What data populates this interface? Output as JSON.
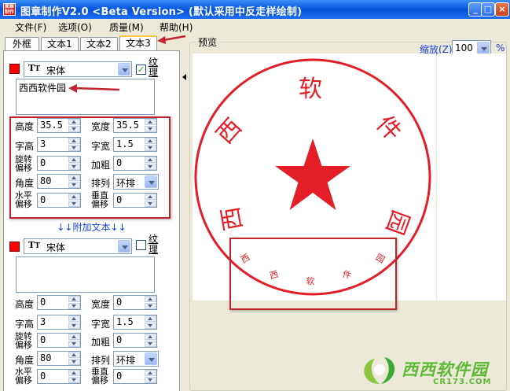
{
  "window": {
    "title": "图章制作V2.0 <Beta Version> (默认采用中反走样绘制)",
    "icon_text": "图章制作"
  },
  "menu": [
    "文件(F)",
    "选项(O)",
    "质量(M)",
    "帮助(H)"
  ],
  "tabs": [
    "外框",
    "文本1",
    "文本2",
    "文本3"
  ],
  "active_tab": "文本3",
  "text1": {
    "color": "#ff0000",
    "font": "宋体",
    "texture_label": "纹理",
    "texture_checked": true,
    "content": "西西软件园",
    "fields": {
      "height": {
        "label": "高度",
        "value": "35.5"
      },
      "width": {
        "label": "宽度",
        "value": "35.5"
      },
      "char_height": {
        "label": "字高",
        "value": "3"
      },
      "char_width": {
        "label": "字宽",
        "value": "1.5"
      },
      "rotate_offset": {
        "label": "旋转偏移",
        "value": "0"
      },
      "bold": {
        "label": "加粗",
        "value": "0"
      },
      "angle": {
        "label": "角度",
        "value": "80"
      },
      "arrange": {
        "label": "排列",
        "value": "环排"
      },
      "h_offset": {
        "label": "水平偏移",
        "value": "0"
      },
      "v_offset": {
        "label": "垂直偏移",
        "value": "0"
      }
    }
  },
  "additional_text_label": "↓↓附加文本↓↓",
  "text2": {
    "color": "#ff0000",
    "font": "宋体",
    "texture_label": "纹理",
    "texture_checked": false,
    "content": "",
    "fields": {
      "height": {
        "label": "高度",
        "value": "0"
      },
      "width": {
        "label": "宽度",
        "value": "0"
      },
      "char_height": {
        "label": "字高",
        "value": "3"
      },
      "char_width": {
        "label": "字宽",
        "value": "1.5"
      },
      "rotate_offset": {
        "label": "旋转偏移",
        "value": "0"
      },
      "bold": {
        "label": "加粗",
        "value": "0"
      },
      "angle": {
        "label": "角度",
        "value": "80"
      },
      "arrange": {
        "label": "排列",
        "value": "环排"
      },
      "h_offset": {
        "label": "水平偏移",
        "value": "0"
      },
      "v_offset": {
        "label": "垂直偏移",
        "value": "0"
      }
    }
  },
  "preview": {
    "group_label": "预览",
    "zoom_label": "缩放(Z)",
    "zoom_value": "100",
    "zoom_unit": "%",
    "stamp_color": "#e41e26",
    "arc_text_top": [
      "西",
      "软",
      "件",
      "园"
    ],
    "arc_text_small": [
      "西",
      "西",
      "软",
      "件",
      "园"
    ]
  },
  "watermark": {
    "brand": "西西软件园",
    "url": "CR173.COM"
  }
}
